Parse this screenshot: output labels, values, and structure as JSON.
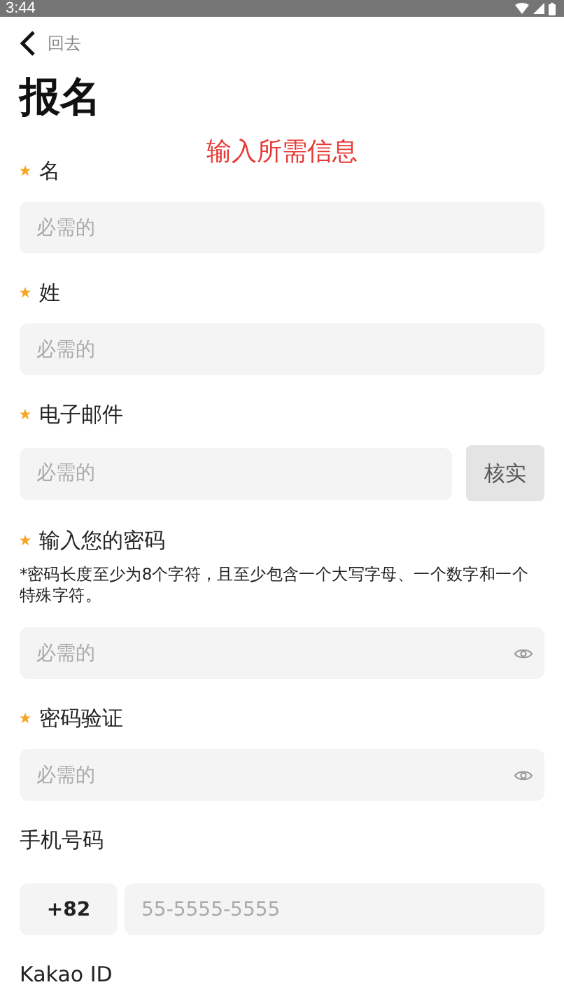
{
  "status_bar": {
    "time": "3:44"
  },
  "back": {
    "label": "回去"
  },
  "title": "报名",
  "notice": "输入所需信息",
  "fields": [
    {
      "kind": "text",
      "label": "名",
      "required": true,
      "placeholder": "必需的"
    },
    {
      "kind": "text",
      "label": "姓",
      "required": true,
      "placeholder": "必需的"
    },
    {
      "kind": "email",
      "label": "电子邮件",
      "required": true,
      "placeholder": "必需的",
      "button": "核实"
    },
    {
      "kind": "password",
      "label": "输入您的密码",
      "required": true,
      "hint": "*密码长度至少为8个字符，且至少包含一个大写字母、一个数字和一个特殊字符。",
      "placeholder": "必需的"
    },
    {
      "kind": "password",
      "label": "密码验证",
      "required": true,
      "placeholder": "必需的"
    },
    {
      "kind": "phone",
      "label": "手机号码",
      "required": false,
      "code": "+82",
      "placeholder": "55-5555-5555"
    },
    {
      "kind": "label",
      "label": "Kakao ID",
      "required": false
    }
  ]
}
